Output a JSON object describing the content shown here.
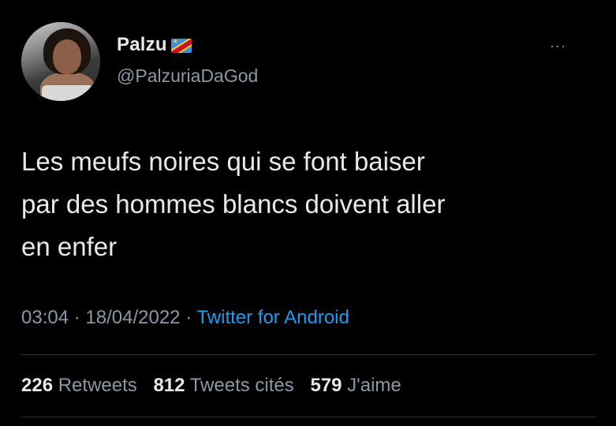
{
  "author": {
    "display_name": "Palzu",
    "handle": "@PalzuriaDaGod",
    "avatar_icon": "profile-photo",
    "badge_icon": "dr-congo-flag-emoji"
  },
  "tweet": {
    "lines": [
      "Les meufs noires qui se font baiser",
      "par des hommes blancs doivent aller",
      "en enfer"
    ],
    "time": "03:04",
    "date": "18/04/2022",
    "separator": "·",
    "source": "Twitter for Android"
  },
  "menu": {
    "more_label": "···"
  },
  "stats": {
    "retweets_count": "226",
    "retweets_label": "Retweets",
    "quotes_count": "812",
    "quotes_label": "Tweets cités",
    "likes_count": "579",
    "likes_label": "J'aime"
  },
  "colors": {
    "background": "#000000",
    "text": "#e7e9ea",
    "secondary": "#8b98a5",
    "link": "#1d9bf0",
    "divider": "#2f3336"
  }
}
